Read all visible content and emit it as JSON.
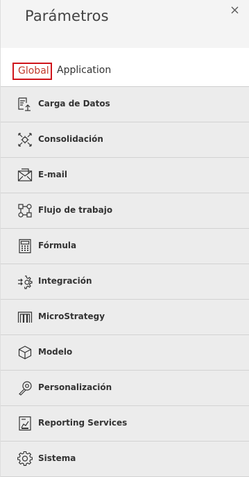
{
  "panel": {
    "title": "Parámetros",
    "close_icon": "close-icon"
  },
  "tabs": [
    {
      "label": "Global",
      "active": true
    },
    {
      "label": "Application",
      "active": false
    }
  ],
  "colors": {
    "active_tab": "#d0141b",
    "item_bg": "#ececec",
    "header_bg": "#f4f4f4"
  },
  "items": [
    {
      "label": "Carga de Datos",
      "icon": "data-upload-icon"
    },
    {
      "label": "Consolidación",
      "icon": "consolidation-icon"
    },
    {
      "label": "E-mail",
      "icon": "email-icon"
    },
    {
      "label": "Flujo de trabajo",
      "icon": "workflow-icon"
    },
    {
      "label": "Fórmula",
      "icon": "calculator-icon"
    },
    {
      "label": "Integración",
      "icon": "integration-icon"
    },
    {
      "label": "MicroStrategy",
      "icon": "microstrategy-icon"
    },
    {
      "label": "Modelo",
      "icon": "cube-icon"
    },
    {
      "label": "Personalización",
      "icon": "wrench-icon"
    },
    {
      "label": "Reporting Services",
      "icon": "report-icon"
    },
    {
      "label": "Sistema",
      "icon": "gear-icon"
    }
  ]
}
